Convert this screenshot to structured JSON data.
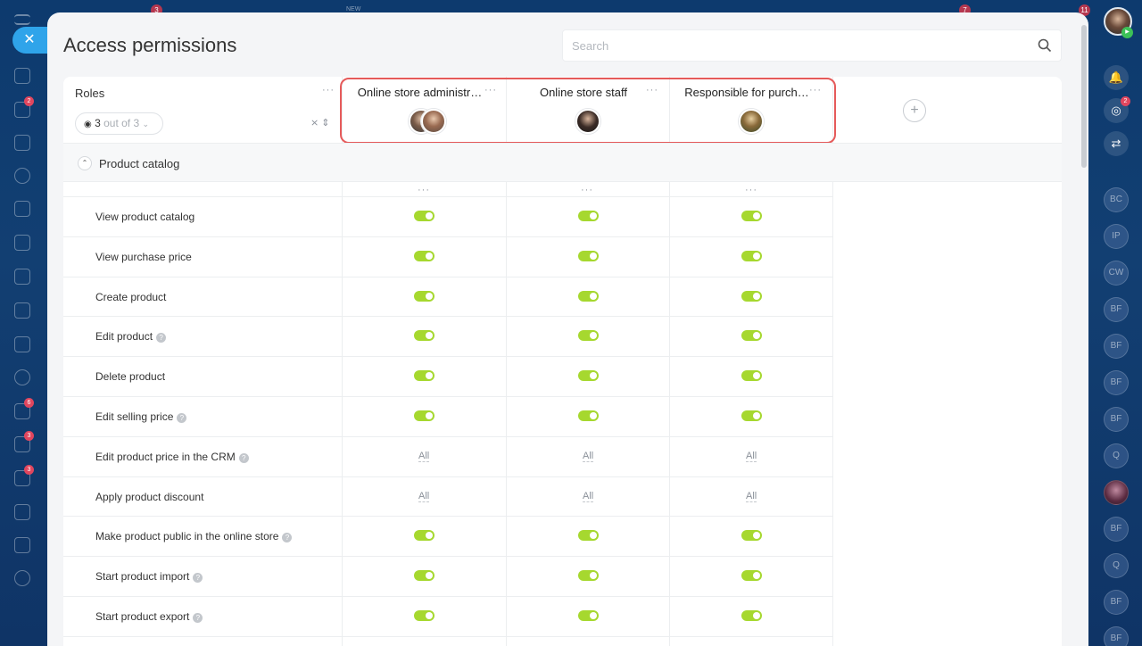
{
  "top_badges": [
    "3",
    "7",
    "11"
  ],
  "top_new": "NEW",
  "left_badges": [
    "2",
    "6",
    "3",
    "3"
  ],
  "right_rail": {
    "notification_badge": "2",
    "contacts": [
      "BC",
      "IP",
      "CW",
      "BF",
      "BF",
      "BF",
      "BF",
      "Q",
      "BF",
      "Q",
      "BF",
      "BF"
    ]
  },
  "page": {
    "title": "Access permissions",
    "search_placeholder": "Search"
  },
  "roles": {
    "label": "Roles",
    "shown_count": "3",
    "shown_total": "out of 3",
    "columns": [
      {
        "title": "Online store administr…"
      },
      {
        "title": "Online store staff"
      },
      {
        "title": "Responsible for purch…"
      }
    ],
    "add_label": "+"
  },
  "section": {
    "title": "Product catalog",
    "rows": [
      {
        "label": "View product catalog",
        "help": false,
        "values": [
          "on",
          "on",
          "on"
        ]
      },
      {
        "label": "View purchase price",
        "help": false,
        "values": [
          "on",
          "on",
          "on"
        ]
      },
      {
        "label": "Create product",
        "help": false,
        "values": [
          "on",
          "on",
          "on"
        ]
      },
      {
        "label": "Edit product",
        "help": true,
        "values": [
          "on",
          "on",
          "on"
        ]
      },
      {
        "label": "Delete product",
        "help": false,
        "values": [
          "on",
          "on",
          "on"
        ]
      },
      {
        "label": "Edit selling price",
        "help": true,
        "values": [
          "on",
          "on",
          "on"
        ]
      },
      {
        "label": "Edit product price in the CRM",
        "help": true,
        "values": [
          "All",
          "All",
          "All"
        ]
      },
      {
        "label": "Apply product discount",
        "help": false,
        "values": [
          "All",
          "All",
          "All"
        ]
      },
      {
        "label": "Make product public in the online store",
        "help": true,
        "values": [
          "on",
          "on",
          "on"
        ]
      },
      {
        "label": "Start product import",
        "help": true,
        "values": [
          "on",
          "on",
          "on"
        ]
      },
      {
        "label": "Start product export",
        "help": true,
        "values": [
          "on",
          "on",
          "on"
        ]
      }
    ]
  },
  "colors": {
    "toggle_on": "#a6d82f",
    "highlight": "#e55a5a",
    "close_button": "#2fa4ea"
  }
}
